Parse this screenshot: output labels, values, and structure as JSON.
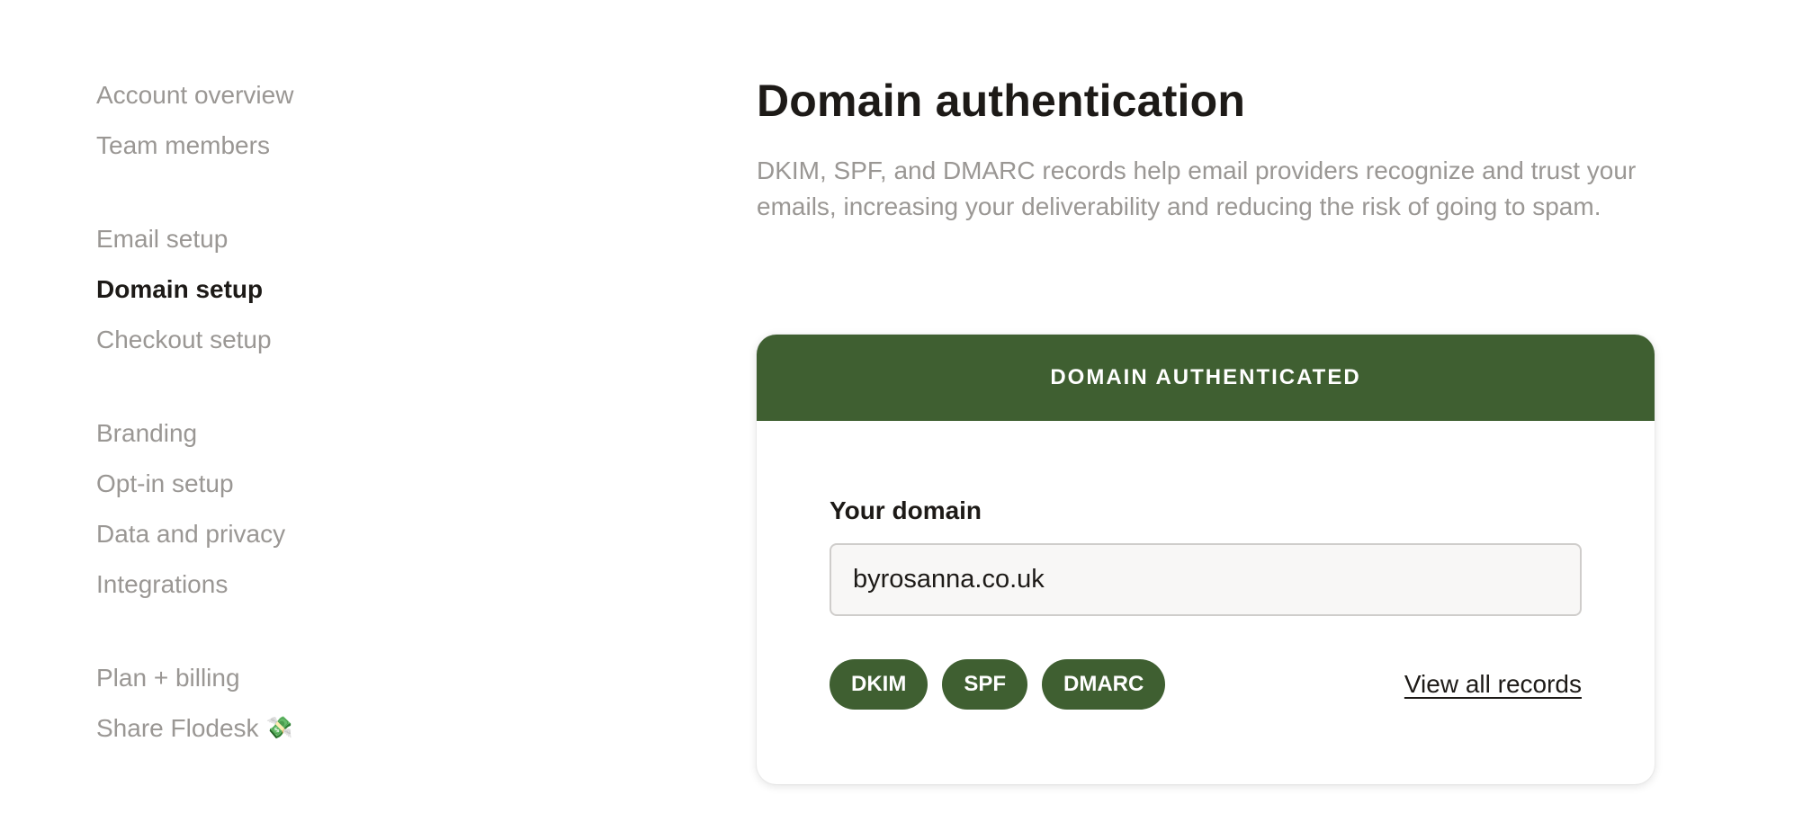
{
  "sidebar": {
    "groups": [
      {
        "items": [
          {
            "label": "Account overview"
          },
          {
            "label": "Team members"
          }
        ]
      },
      {
        "items": [
          {
            "label": "Email setup"
          },
          {
            "label": "Domain setup",
            "active": true
          },
          {
            "label": "Checkout setup"
          }
        ]
      },
      {
        "items": [
          {
            "label": "Branding"
          },
          {
            "label": "Opt-in setup"
          },
          {
            "label": "Data and privacy"
          },
          {
            "label": "Integrations"
          }
        ]
      },
      {
        "items": [
          {
            "label": "Plan + billing"
          },
          {
            "label": "Share Flodesk",
            "emoji": "💸"
          }
        ]
      }
    ]
  },
  "main": {
    "title": "Domain authentication",
    "description": "DKIM, SPF, and DMARC records help email providers recognize and trust your emails, increasing your deliverability and reducing the risk of going to spam.",
    "card": {
      "status": "DOMAIN AUTHENTICATED",
      "field_label": "Your domain",
      "domain_value": "byrosanna.co.uk",
      "records": [
        "DKIM",
        "SPF",
        "DMARC"
      ],
      "view_all_label": "View all records"
    }
  },
  "colors": {
    "accent_green": "#3f5f31",
    "text_primary": "#1d1a17",
    "text_muted": "#9a9794"
  }
}
